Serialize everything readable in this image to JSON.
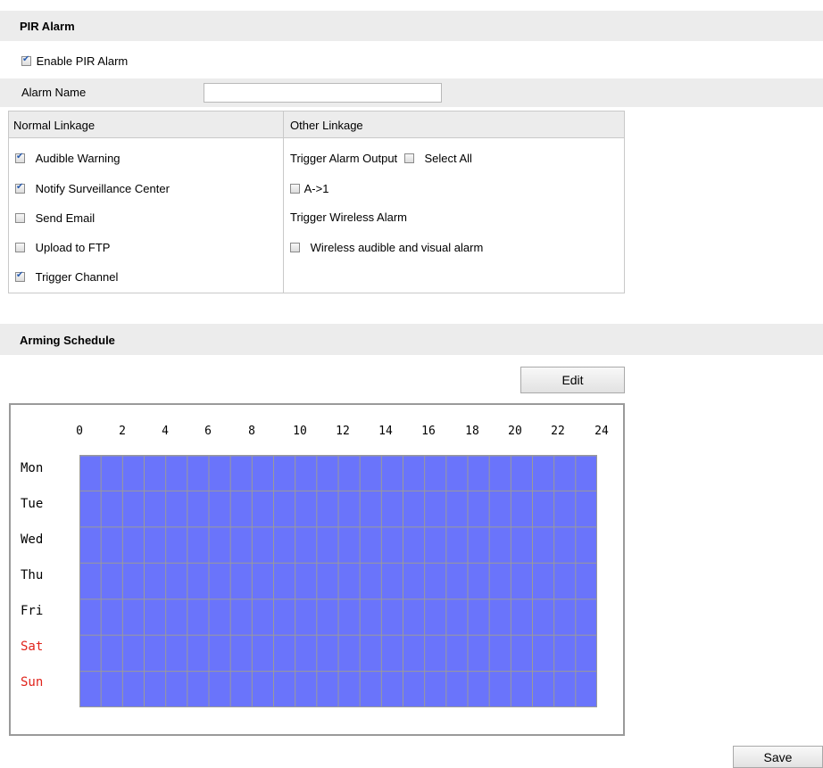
{
  "pir_section": {
    "title": "PIR Alarm"
  },
  "enable_pir": {
    "label": "Enable PIR Alarm",
    "checked": true
  },
  "alarm_name": {
    "label": "Alarm Name",
    "value": ""
  },
  "normal_linkage": {
    "header": "Normal Linkage",
    "items": [
      {
        "label": "Audible Warning",
        "checked": true
      },
      {
        "label": "Notify Surveillance Center",
        "checked": true
      },
      {
        "label": "Send Email",
        "checked": false
      },
      {
        "label": "Upload to FTP",
        "checked": false
      },
      {
        "label": "Trigger Channel",
        "checked": true
      }
    ]
  },
  "other_linkage": {
    "header": "Other Linkage",
    "trigger_alarm_output": "Trigger Alarm Output",
    "select_all": {
      "label": "Select All",
      "checked": false
    },
    "output_a1": {
      "label": "A->1",
      "checked": false
    },
    "trigger_wireless_alarm": "Trigger Wireless Alarm",
    "wireless_audible": {
      "label": "Wireless audible and visual alarm",
      "checked": false
    }
  },
  "arming_section": {
    "title": "Arming Schedule"
  },
  "edit_button": {
    "label": "Edit"
  },
  "schedule": {
    "hours": [
      "0",
      "2",
      "4",
      "6",
      "8",
      "10",
      "12",
      "14",
      "16",
      "18",
      "20",
      "22",
      "24"
    ],
    "days": [
      {
        "label": "Mon",
        "weekend": false
      },
      {
        "label": "Tue",
        "weekend": false
      },
      {
        "label": "Wed",
        "weekend": false
      },
      {
        "label": "Thu",
        "weekend": false
      },
      {
        "label": "Fri",
        "weekend": false
      },
      {
        "label": "Sat",
        "weekend": true
      },
      {
        "label": "Sun",
        "weekend": true
      }
    ],
    "armed_hours_per_day": [
      24,
      24,
      24,
      24,
      24,
      24,
      24
    ],
    "fill_color": "#6a74fb",
    "grid_color": "#9a9a9a",
    "weekend_color": "#e0231b"
  },
  "save_button": {
    "label": "Save"
  }
}
